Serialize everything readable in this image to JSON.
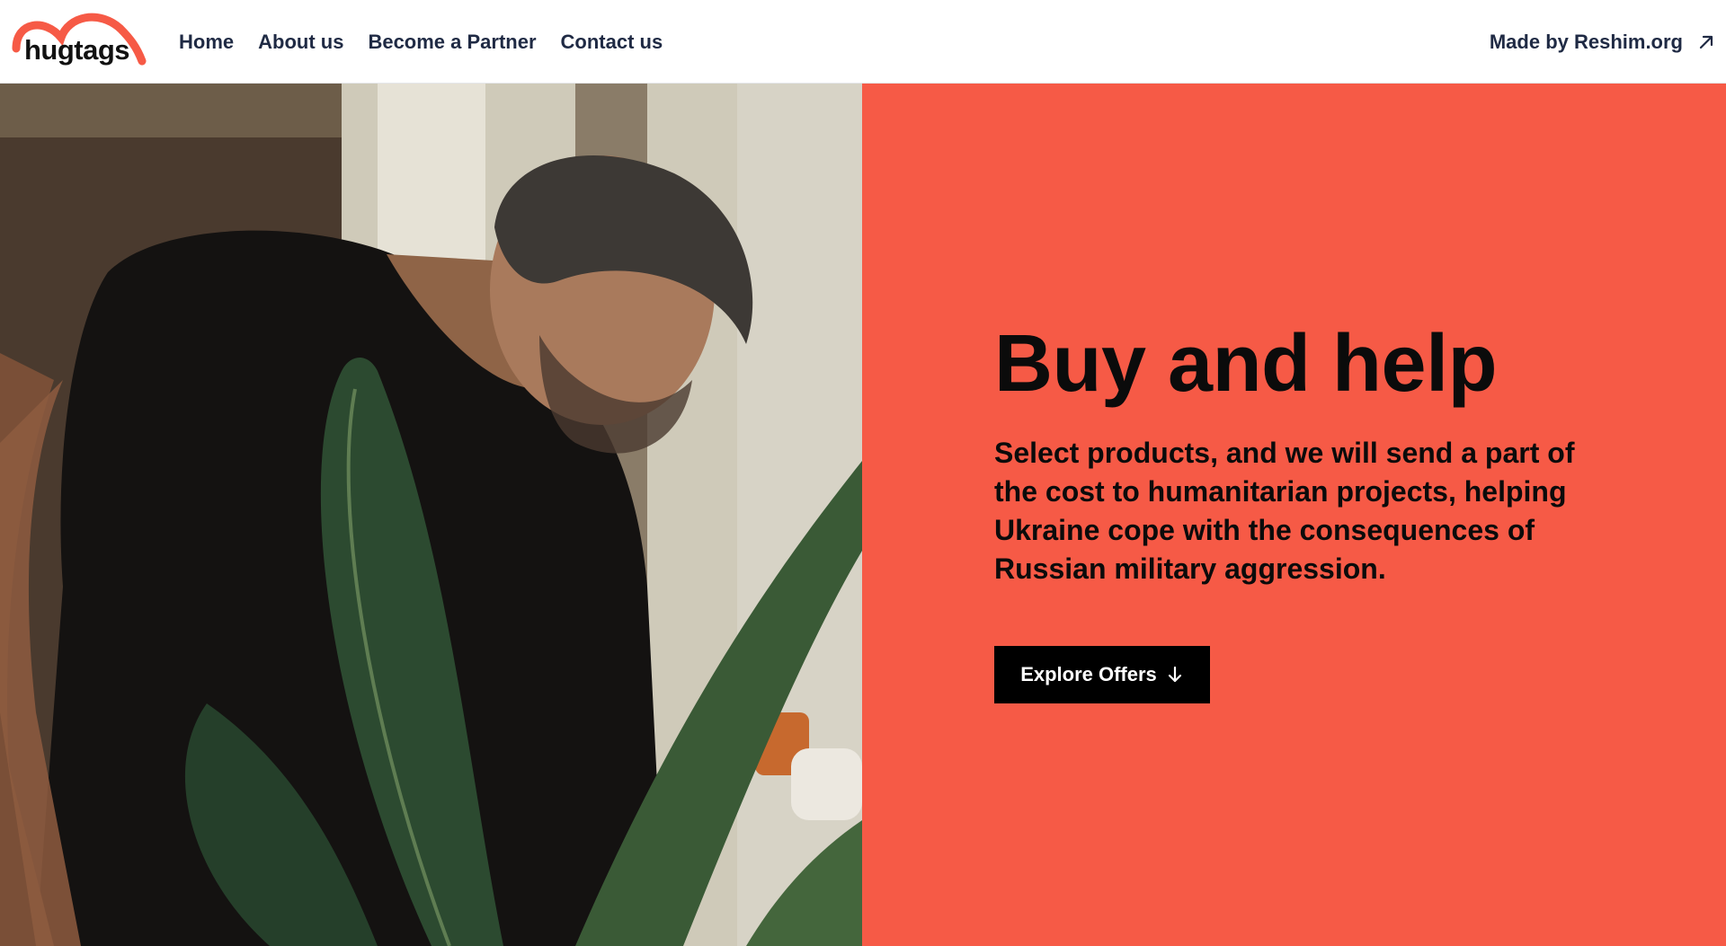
{
  "brand": {
    "name": "hugtags",
    "accent": "#f65a46"
  },
  "nav": {
    "items": [
      {
        "label": "Home"
      },
      {
        "label": "About us"
      },
      {
        "label": "Become a Partner"
      },
      {
        "label": "Contact us"
      }
    ]
  },
  "made_by": {
    "label": "Made by Reshim.org",
    "icon": "external-link-arrow-icon"
  },
  "hero": {
    "image": "man-tending-plant-photo",
    "title": "Buy and help",
    "subtitle": "Select products, and we will send a part of the cost to humanitarian projects, helping Ukraine cope with the consequences of Russian military aggression.",
    "cta_label": "Explore Offers",
    "cta_icon": "arrow-down-icon",
    "panel_color": "#f65a46"
  }
}
